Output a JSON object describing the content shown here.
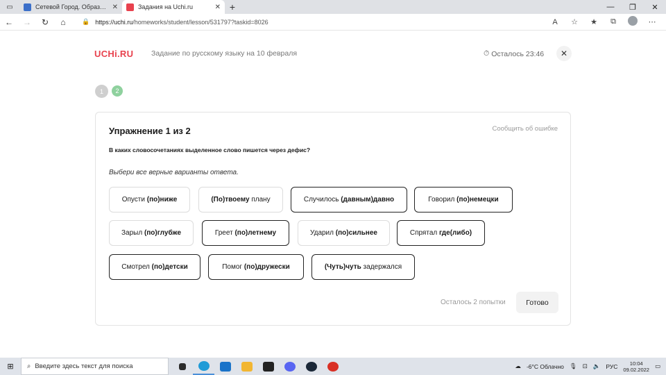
{
  "browser": {
    "tabs": [
      {
        "title": "Сетевой Город. Образование. П",
        "favicon_color": "#3b6fc9",
        "active": false
      },
      {
        "title": "Задания на Uchi.ru",
        "favicon_color": "#e8424e",
        "active": true
      }
    ],
    "new_tab_label": "+",
    "url": {
      "host": "https://uchi.ru",
      "path": "/homeworks/student/lesson/531797?taskid=8026"
    }
  },
  "header": {
    "logo": "UCHi.RU",
    "task_title": "Задание по русскому языку на 10 февраля",
    "timer": "Осталось 23:46",
    "close_icon": "close-icon"
  },
  "steps": [
    "1",
    "2"
  ],
  "exercise": {
    "title": "Упражнение 1 из 2",
    "report_link": "Сообщить об ошибке",
    "question": "В каких словосочетаниях выделенное слово пишется через дефис?",
    "hint": "Выбери все верные варианты ответа.",
    "options": [
      {
        "plain": "Опусти ",
        "bold": "(по)ниже",
        "after": "",
        "selected": false
      },
      {
        "plain": "",
        "bold": "(По)твоему",
        "after": " плану",
        "selected": false
      },
      {
        "plain": "Случилось ",
        "bold": "(давным)давно",
        "after": "",
        "selected": true
      },
      {
        "plain": "Говорил ",
        "bold": "(по)немецки",
        "after": "",
        "selected": true
      },
      {
        "plain": "Зарыл ",
        "bold": "(по)глубже",
        "after": "",
        "selected": false
      },
      {
        "plain": "Греет ",
        "bold": "(по)летнему",
        "after": "",
        "selected": true
      },
      {
        "plain": "Ударил ",
        "bold": "(по)сильнее",
        "after": "",
        "selected": false
      },
      {
        "plain": "Спрятал ",
        "bold": "где(либо)",
        "after": "",
        "selected": true
      },
      {
        "plain": "Смотрел ",
        "bold": "(по)детски",
        "after": "",
        "selected": true
      },
      {
        "plain": "Помог ",
        "bold": "(по)дружески",
        "after": "",
        "selected": true
      },
      {
        "plain": "",
        "bold": "(Чуть)чуть",
        "after": " задержался",
        "selected": true
      }
    ],
    "attempts": "Осталось 2 попытки",
    "done_button": "Готово"
  },
  "taskbar": {
    "search_placeholder": "Введите здесь текст для поиска",
    "weather": "-6°C  Облачно",
    "language": "РУС",
    "time": "10:04",
    "date": "09.02.2022"
  }
}
